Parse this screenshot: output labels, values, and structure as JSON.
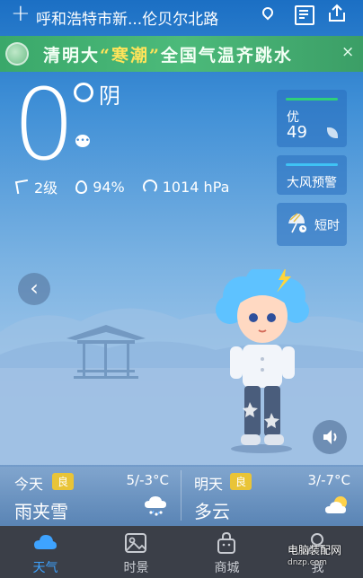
{
  "top_bar": {
    "add_symbol": "+",
    "location": "呼和浩特市新...伦贝尔北路"
  },
  "banner": {
    "text_before": "清明大",
    "text_highlight": "“寒潮”",
    "text_after": "全国气温齐跳水",
    "close": "×"
  },
  "current": {
    "temperature": "0",
    "condition": "阴",
    "wind": "2级",
    "humidity": "94%",
    "pressure": "1014 hPa"
  },
  "cards": {
    "aqi_label": "优",
    "aqi_value": "49",
    "aqi_color": "#2fd07a",
    "wind_warning": "大风预警",
    "wind_warning_color": "#3fc3f5",
    "short_forecast": "短时"
  },
  "forecast": {
    "today": {
      "day": "今天",
      "air_quality": "良",
      "range": "5/-3°C",
      "condition": "雨夹雪",
      "icon": "sleet-icon"
    },
    "tomorrow": {
      "day": "明天",
      "air_quality": "良",
      "range": "3/-7°C",
      "condition": "多云",
      "icon": "partly-cloudy-icon"
    }
  },
  "nav": {
    "items": [
      {
        "label": "天气",
        "icon": "cloud-icon",
        "active": true
      },
      {
        "label": "时景",
        "icon": "picture-icon",
        "active": false
      },
      {
        "label": "商城",
        "icon": "bag-icon",
        "active": false
      },
      {
        "label": "我",
        "icon": "person-icon",
        "active": false
      }
    ],
    "active_color": "#3ea3ff"
  },
  "watermark": {
    "title": "电脑装配网",
    "url": "dnzp.com"
  }
}
